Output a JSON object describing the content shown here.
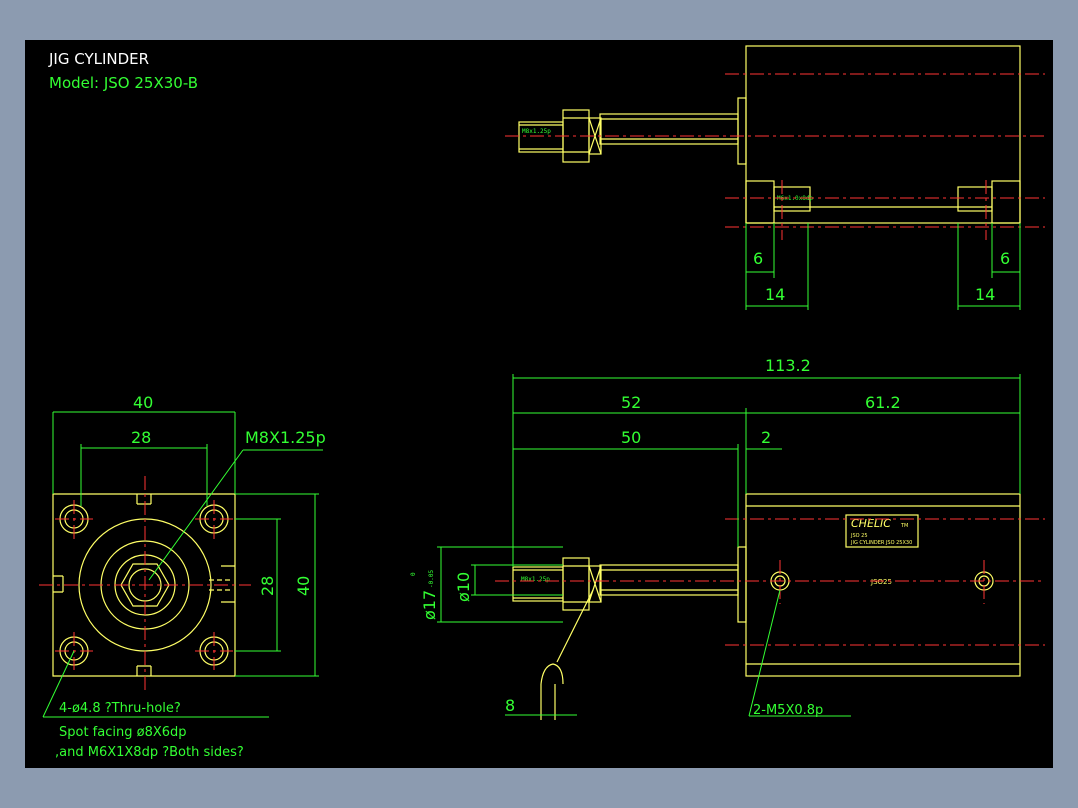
{
  "title": {
    "line1": "JIG CYLINDER",
    "line2": "Model:  JSO 25X30-B"
  },
  "colors": {
    "background": "#000000",
    "outline": "#ffff66",
    "dimension": "#33ff33",
    "centerline": "#ff3333",
    "frame": "#8c9bb0"
  },
  "top_view": {
    "thread_label": "M8x1.25p",
    "port_label": "M6x1.0x8dp",
    "dims": {
      "left_6": "6",
      "right_6": "6",
      "left_14": "14",
      "right_14": "14"
    }
  },
  "front_view": {
    "dims": {
      "width_40": "40",
      "pitch_28": "28",
      "height_28": "28",
      "height_40": "40"
    },
    "rod_thread": "M8X1.25p",
    "hole_note": "4-ø4.8 ?Thru-hole?",
    "spot_note": "Spot facing  ø8X6dp",
    "tap_note": ",and  M6X1X8dp ?Both sides?"
  },
  "side_view": {
    "dims": {
      "total": "113.2",
      "d52": "52",
      "d61": "61.2",
      "d50": "50",
      "d2": "2",
      "d8": "8",
      "rod_dia": "ø10",
      "bore_dia": "ø17",
      "tol_upper": "0",
      "tol_lower": "-0.05"
    },
    "thread_label": "M8x1.25p",
    "port_note": "2-M5X0.8p",
    "brand": "CHELIC",
    "brand_mark": "TM",
    "plate_line1": "JSO 25",
    "plate_line2": "JIG CYLINDER  JSO 25X30",
    "model_label": "JSO25"
  }
}
